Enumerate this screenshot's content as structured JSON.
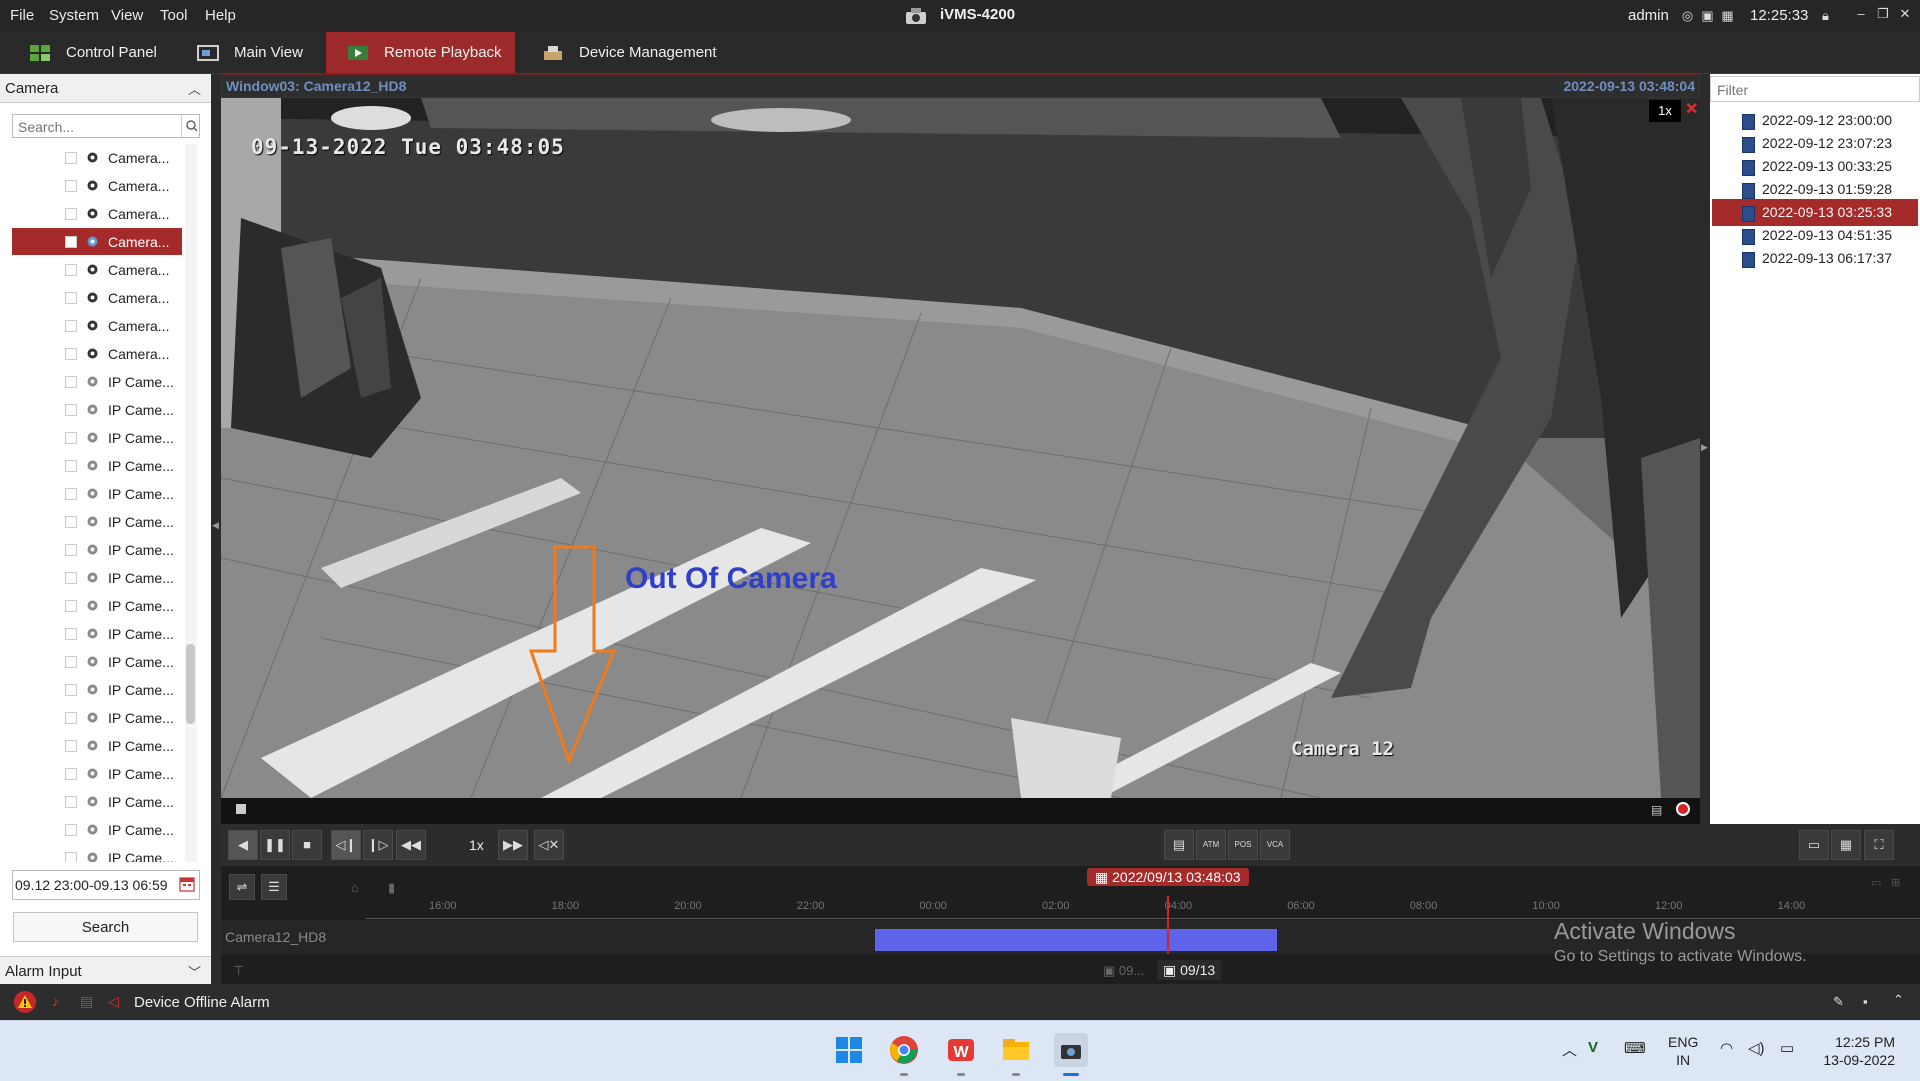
{
  "menu": [
    "File",
    "System",
    "View",
    "Tool",
    "Help"
  ],
  "app_title": "iVMS-4200",
  "user": "admin",
  "clock": "12:25:33",
  "tabs": [
    {
      "label": "Control Panel",
      "active": false
    },
    {
      "label": "Main View",
      "active": false
    },
    {
      "label": "Remote Playback",
      "active": true
    },
    {
      "label": "Device Management",
      "active": false
    }
  ],
  "left_panel": {
    "header": "Camera",
    "search_placeholder": "Search...",
    "cameras": [
      {
        "label": "Camera...",
        "type": "analog",
        "selected": false
      },
      {
        "label": "Camera...",
        "type": "analog",
        "selected": false
      },
      {
        "label": "Camera...",
        "type": "analog",
        "selected": false
      },
      {
        "label": "Camera...",
        "type": "analog",
        "selected": true
      },
      {
        "label": "Camera...",
        "type": "analog",
        "selected": false
      },
      {
        "label": "Camera...",
        "type": "analog",
        "selected": false
      },
      {
        "label": "Camera...",
        "type": "analog",
        "selected": false
      },
      {
        "label": "Camera...",
        "type": "analog",
        "selected": false
      },
      {
        "label": "IP Came...",
        "type": "ip",
        "selected": false
      },
      {
        "label": "IP Came...",
        "type": "ip",
        "selected": false
      },
      {
        "label": "IP Came...",
        "type": "ip",
        "selected": false
      },
      {
        "label": "IP Came...",
        "type": "ip",
        "selected": false
      },
      {
        "label": "IP Came...",
        "type": "ip",
        "selected": false
      },
      {
        "label": "IP Came...",
        "type": "ip",
        "selected": false
      },
      {
        "label": "IP Came...",
        "type": "ip",
        "selected": false
      },
      {
        "label": "IP Came...",
        "type": "ip",
        "selected": false
      },
      {
        "label": "IP Came...",
        "type": "ip",
        "selected": false
      },
      {
        "label": "IP Came...",
        "type": "ip",
        "selected": false
      },
      {
        "label": "IP Came...",
        "type": "ip",
        "selected": false
      },
      {
        "label": "IP Came...",
        "type": "ip",
        "selected": false
      },
      {
        "label": "IP Came...",
        "type": "ip",
        "selected": false
      },
      {
        "label": "IP Came...",
        "type": "ip",
        "selected": false
      },
      {
        "label": "IP Came...",
        "type": "ip",
        "selected": false
      },
      {
        "label": "IP Came...",
        "type": "ip",
        "selected": false
      },
      {
        "label": "IP Came...",
        "type": "ip",
        "selected": false
      },
      {
        "label": "IP Came...",
        "type": "ip",
        "selected": false
      }
    ],
    "time_range": "09.12 23:00-09.13 06:59",
    "search_button": "Search",
    "alarm_header": "Alarm Input"
  },
  "video": {
    "window_label": "Window03:  Camera12_HD8",
    "window_time": "2022-09-13 03:48:04",
    "osd_time": "09-13-2022 Tue 03:48:05",
    "osd_camera": "Camera 12",
    "speed": "1x",
    "annotation": "Out Of Camera"
  },
  "right_panel": {
    "filter_placeholder": "Filter",
    "records": [
      {
        "label": "2022-09-12 23:00:00",
        "selected": false
      },
      {
        "label": "2022-09-12 23:07:23",
        "selected": false
      },
      {
        "label": "2022-09-13 00:33:25",
        "selected": false
      },
      {
        "label": "2022-09-13 01:59:28",
        "selected": false
      },
      {
        "label": "2022-09-13 03:25:33",
        "selected": true
      },
      {
        "label": "2022-09-13 04:51:35",
        "selected": false
      },
      {
        "label": "2022-09-13 06:17:37",
        "selected": false
      }
    ]
  },
  "controls": {
    "speed": "1x",
    "feature_labels": [
      "ATM",
      "POS",
      "VCA"
    ]
  },
  "timeline": {
    "current": "2022/09/13 03:48:03",
    "ticks": [
      "16:00",
      "18:00",
      "20:00",
      "22:00",
      "00:00",
      "02:00",
      "04:00",
      "06:00",
      "08:00",
      "10:00",
      "12:00",
      "14:00"
    ],
    "track_label": "Camera12_HD8",
    "date_prev": "09...",
    "date_current": "09/13"
  },
  "watermark": {
    "title": "Activate Windows",
    "subtitle": "Go to Settings to activate Windows."
  },
  "alarm_bar": {
    "text": "Device Offline Alarm"
  },
  "taskbar": {
    "lang": "ENG",
    "region": "IN",
    "time": "12:25 PM",
    "date": "13-09-2022"
  },
  "colors": {
    "accent": "#a52a2a",
    "timeline_segment": "#5d64ea",
    "annotation": "#2f3fc8",
    "arrow": "#f07a1c"
  }
}
